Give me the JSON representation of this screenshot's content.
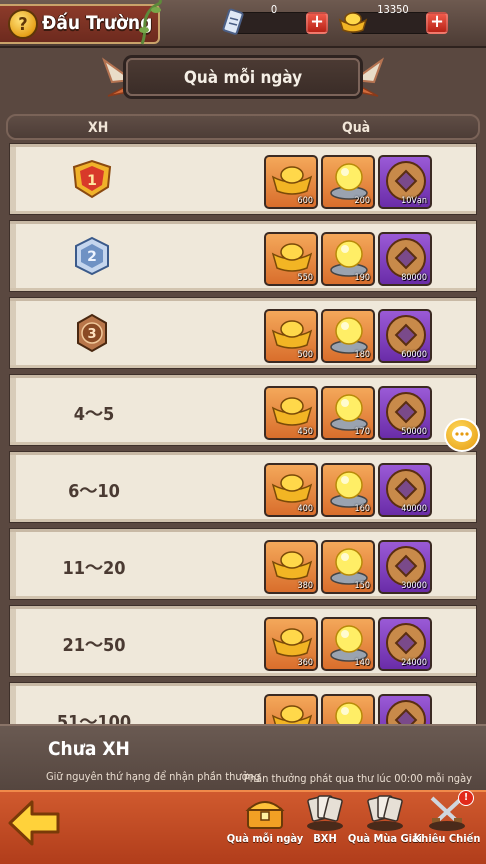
{
  "header": {
    "title": "Đấu Trường",
    "currencies": [
      {
        "icon": "ticket-icon",
        "value": "0"
      },
      {
        "icon": "gold-ingot-icon",
        "value": "13350"
      }
    ]
  },
  "banner": {
    "title": "Quà mỗi ngày"
  },
  "table": {
    "col_rank": "XH",
    "col_reward": "Quà",
    "rows": [
      {
        "rank": "1",
        "rank_type": "medal-gold",
        "rewards": [
          "600",
          "200",
          "10Vạn"
        ]
      },
      {
        "rank": "2",
        "rank_type": "medal-silver",
        "rewards": [
          "550",
          "190",
          "80000"
        ]
      },
      {
        "rank": "3",
        "rank_type": "medal-bronze",
        "rewards": [
          "500",
          "180",
          "60000"
        ]
      },
      {
        "rank": "4～5",
        "rank_type": "text",
        "rewards": [
          "450",
          "170",
          "50000"
        ]
      },
      {
        "rank": "6～10",
        "rank_type": "text",
        "rewards": [
          "400",
          "160",
          "40000"
        ]
      },
      {
        "rank": "11～20",
        "rank_type": "text",
        "rewards": [
          "380",
          "150",
          "30000"
        ]
      },
      {
        "rank": "21～50",
        "rank_type": "text",
        "rewards": [
          "360",
          "140",
          "24000"
        ]
      },
      {
        "rank": "51～100",
        "rank_type": "text",
        "rewards": [
          "",
          "",
          ""
        ]
      }
    ]
  },
  "status": {
    "rank_label": "Chưa XH",
    "hint_left": "Giữ nguyên thứ hạng để nhận phần thưởng",
    "hint_right": "Phần thưởng phát qua thư lúc 00:00 mỗi ngày"
  },
  "nav": {
    "items": [
      {
        "label": "Quà mỗi ngày",
        "icon": "treasure-chest-icon"
      },
      {
        "label": "BXH",
        "icon": "cards-icon"
      },
      {
        "label": "Quà Mùa Giải",
        "icon": "season-cards-icon"
      },
      {
        "label": "Khiêu Chiến",
        "icon": "crossed-swords-icon"
      }
    ],
    "badge": "!"
  }
}
